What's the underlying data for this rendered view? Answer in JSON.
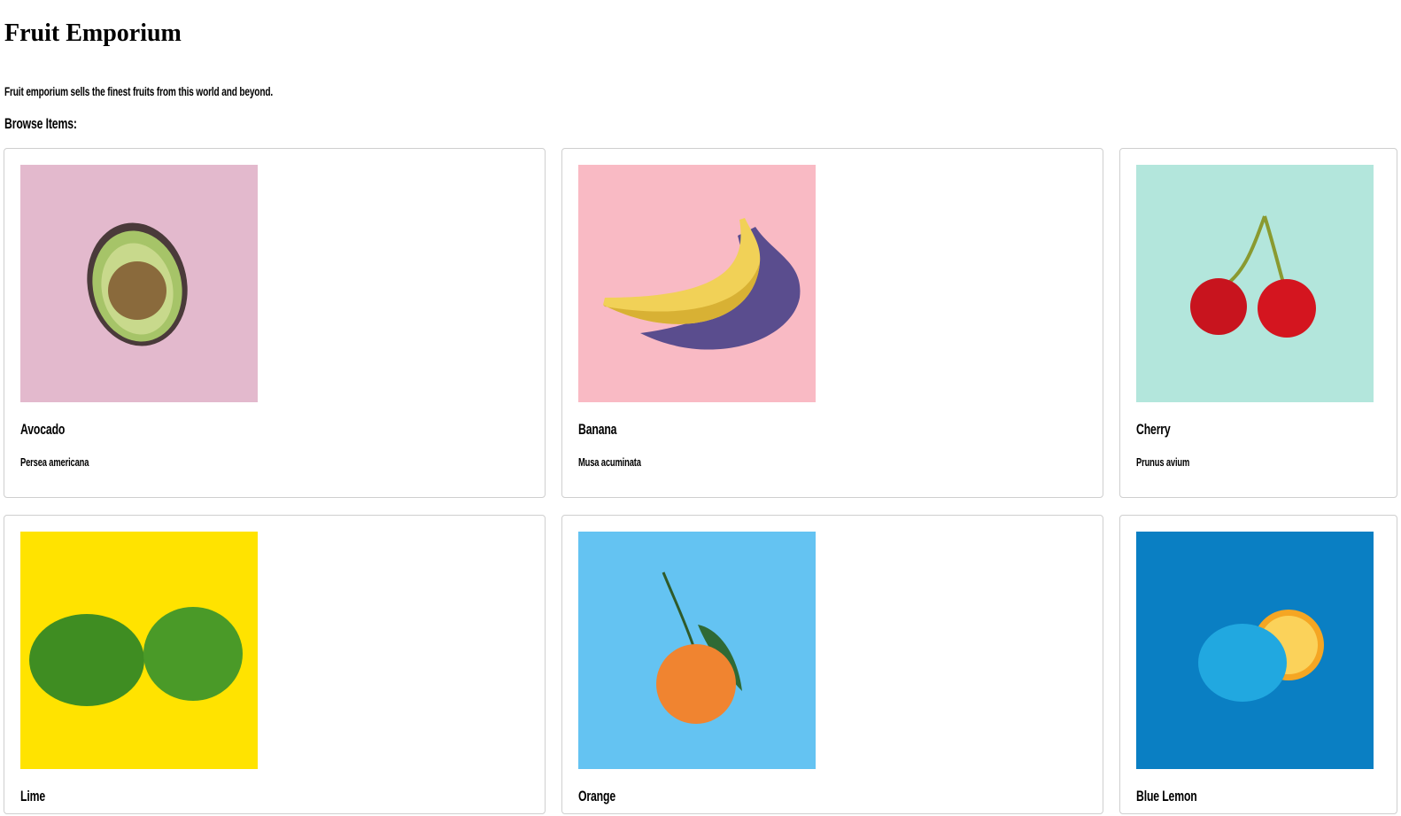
{
  "header": {
    "title": "Fruit Emporium",
    "description": "Fruit emporium sells the finest fruits from this world and beyond.",
    "browse_label": "Browse Items:"
  },
  "items": [
    {
      "name": "Avocado",
      "species": "Persea americana",
      "bg": "#e3b9cd"
    },
    {
      "name": "Banana",
      "species": "Musa acuminata",
      "bg": "#f9bac4"
    },
    {
      "name": "Cherry",
      "species": "Prunus avium",
      "bg": "#b3e6dc"
    },
    {
      "name": "Lime",
      "species": "",
      "bg": "#ffe300"
    },
    {
      "name": "Orange",
      "species": "",
      "bg": "#64c3f2"
    },
    {
      "name": "Blue Lemon",
      "species": "",
      "bg": "#0a7fc3"
    }
  ]
}
